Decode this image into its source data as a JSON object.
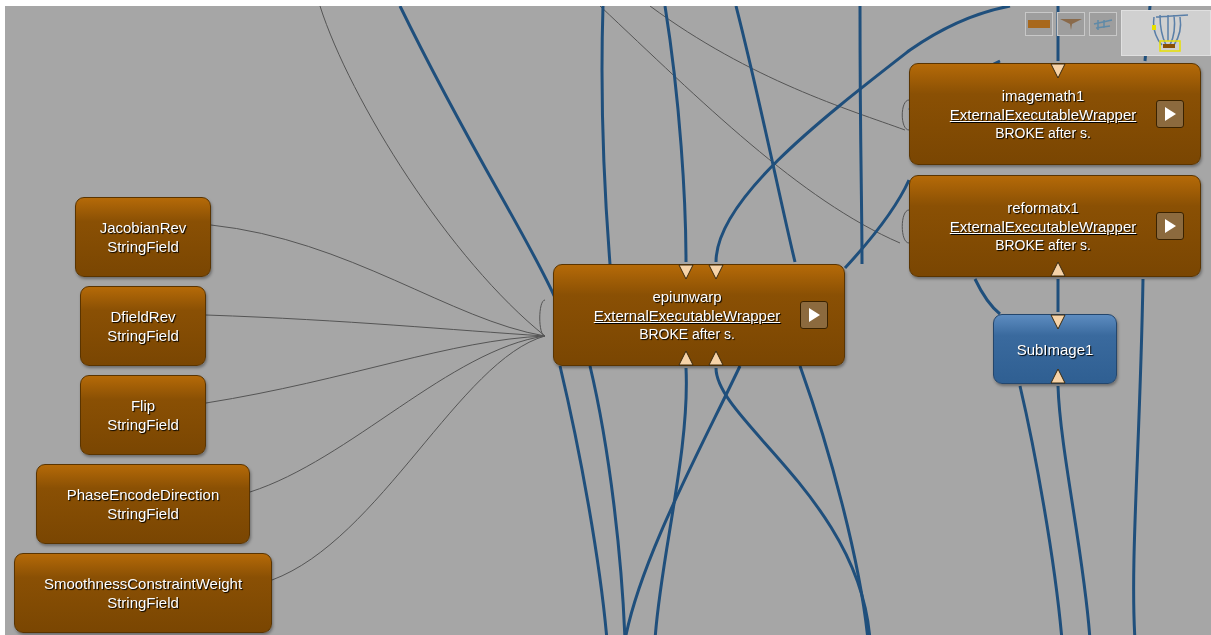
{
  "toolbar": {
    "thumbnails": [
      {
        "kind": "bar"
      },
      {
        "kind": "fan"
      },
      {
        "kind": "tree"
      }
    ]
  },
  "canvas": {
    "nodes": [
      {
        "kind": "field",
        "name": "JacobianRev",
        "type": "StringField"
      },
      {
        "kind": "field",
        "name": "DfieldRev",
        "type": "StringField"
      },
      {
        "kind": "field",
        "name": "Flip",
        "type": "StringField"
      },
      {
        "kind": "field",
        "name": "PhaseEncodeDirection",
        "type": "StringField"
      },
      {
        "kind": "field",
        "name": "SmoothnessConstraintWeight",
        "type": "StringField"
      },
      {
        "kind": "wrapper",
        "name": "epiunwarp",
        "type": "ExternalExecutableWrapper",
        "status": "BROKE after s."
      },
      {
        "kind": "wrapper",
        "name": "imagemath1",
        "type": "ExternalExecutableWrapper",
        "status": "BROKE after s."
      },
      {
        "kind": "wrapper",
        "name": "reformatx1",
        "type": "ExternalExecutableWrapper",
        "status": "BROKE after s."
      },
      {
        "kind": "image",
        "name": "SubImage1"
      }
    ]
  }
}
